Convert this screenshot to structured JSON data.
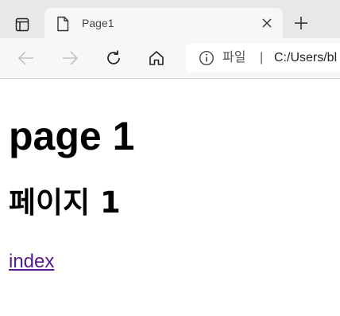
{
  "browser": {
    "tab": {
      "title": "Page1"
    },
    "address_bar": {
      "scheme_label": "파일",
      "separator": "|",
      "url": "C:/Users/bl"
    }
  },
  "page": {
    "heading1": "page 1",
    "heading2": "페이지 1",
    "link_text": "index"
  },
  "colors": {
    "visited_link": "#551a8b"
  }
}
